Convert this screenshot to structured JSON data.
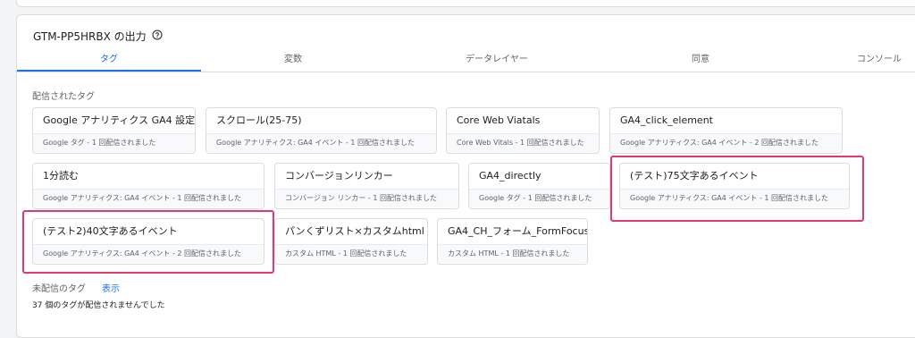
{
  "header": {
    "title": "GTM-PP5HRBX の出力",
    "help_icon": "help-circle-icon"
  },
  "tabs": [
    {
      "label": "タグ",
      "active": true
    },
    {
      "label": "変数",
      "active": false
    },
    {
      "label": "データレイヤー",
      "active": false
    },
    {
      "label": "同意",
      "active": false
    },
    {
      "label": "コンソール",
      "active": false
    }
  ],
  "fired_section": {
    "title": "配信されたタグ",
    "tags": [
      {
        "name": "Google アナリティクス GA4 設定",
        "detail": "Google タグ - 1 回配信されました",
        "highlighted": false
      },
      {
        "name": "スクロール(25-75)",
        "detail": "Google アナリティクス: GA4 イベント - 1 回配信されました",
        "highlighted": false
      },
      {
        "name": "Core Web Viatals",
        "detail": "Core Web Vitals - 1 回配信されました",
        "highlighted": false
      },
      {
        "name": "GA4_click_element",
        "detail": "Google アナリティクス: GA4 イベント - 2 回配信されました",
        "highlighted": false
      },
      {
        "name": "1分読む",
        "detail": "Google アナリティクス: GA4 イベント - 1 回配信されました",
        "highlighted": false
      },
      {
        "name": "コンバージョンリンカー",
        "detail": "コンバージョン リンカー - 1 回配信されました",
        "highlighted": false
      },
      {
        "name": "GA4_directly",
        "detail": "Google タグ - 1 回配信されました",
        "highlighted": false
      },
      {
        "name": "(テスト)75文字あるイベント",
        "detail": "Google アナリティクス: GA4 イベント - 1 回配信されました",
        "highlighted": true
      },
      {
        "name": "(テスト2)40文字あるイベント",
        "detail": "Google アナリティクス: GA4 イベント - 2 回配信されました",
        "highlighted": true
      },
      {
        "name": "パンくずリスト×カスタムhtml",
        "detail": "カスタム HTML - 1 回配信されました",
        "highlighted": false
      },
      {
        "name": "GA4_CH_フォーム_FormFocus",
        "detail": "カスタム HTML - 1 回配信されました",
        "highlighted": false
      }
    ]
  },
  "unfired_section": {
    "title": "未配信のタグ",
    "show_link": "表示",
    "count_text": "37 個のタグが配信されませんでした"
  },
  "colors": {
    "accent": "#1a73e8",
    "highlight": "#e2386e"
  }
}
